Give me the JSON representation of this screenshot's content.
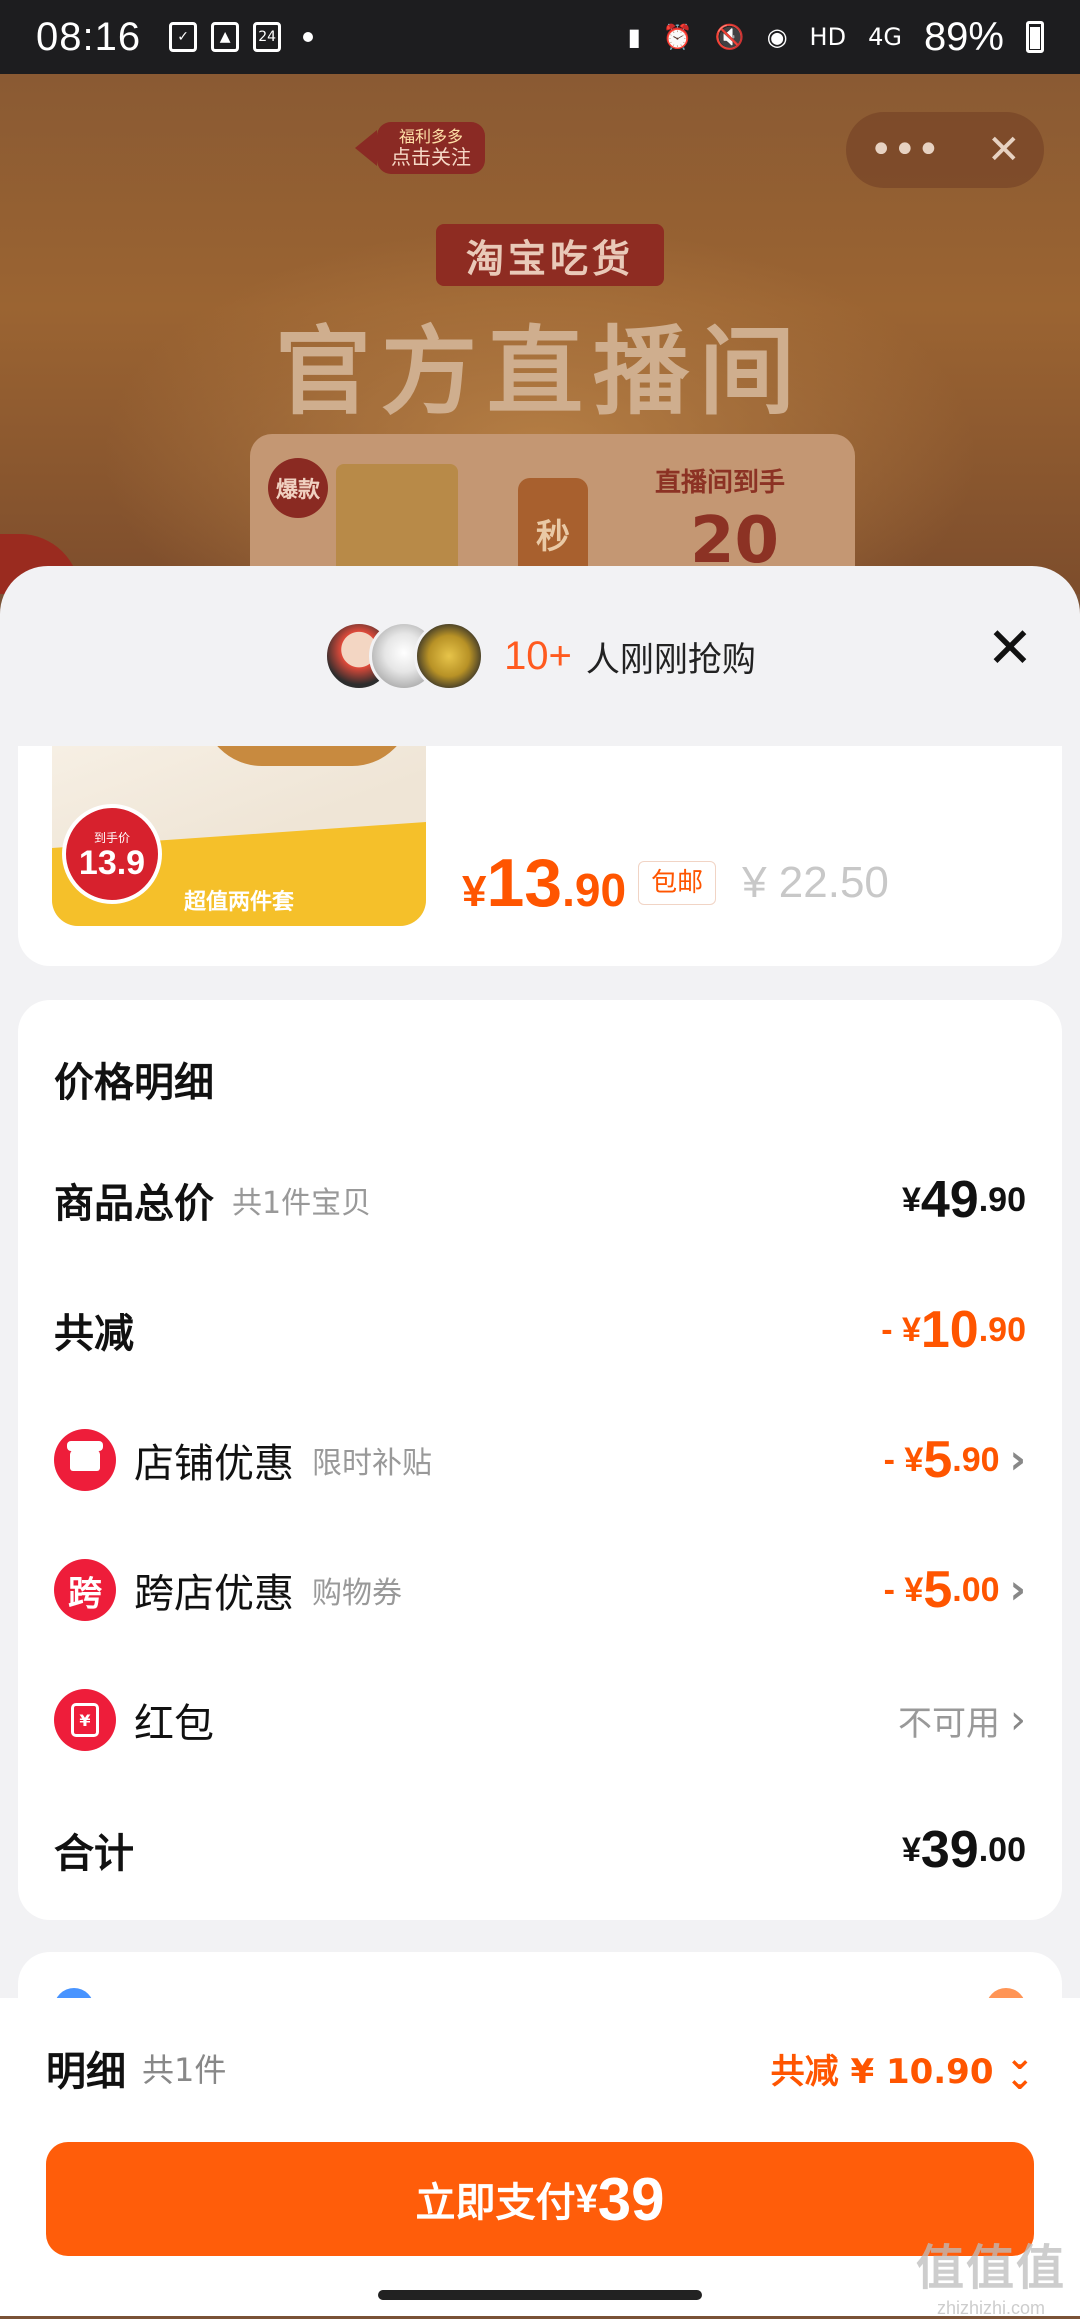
{
  "status_bar": {
    "time": "08:16",
    "network": "HD",
    "signal": "4G",
    "battery": "89%"
  },
  "live_room": {
    "follow_top": "福利多多",
    "follow_bottom": "点击关注",
    "tag": "淘宝吃货",
    "title": "官方直播间",
    "promo_hot": "爆款",
    "promo_sec": "秒",
    "promo_text": "直播间到手",
    "promo_num": "20",
    "controls_more": "•••",
    "controls_close": "✕"
  },
  "sheet": {
    "buyers_count": "10+",
    "buyers_text": "人刚刚抢购",
    "close": "✕"
  },
  "product": {
    "badge_label": "到手价",
    "badge_price": "13.9",
    "combo_label": "超值两件套",
    "price_symbol": "¥",
    "price_int": "13",
    "price_dec": ".90",
    "shipping_tag": "包邮",
    "original_price": "¥ 22.50"
  },
  "price_detail": {
    "title": "价格明细",
    "total_label": "商品总价",
    "total_sub": "共1件宝贝",
    "total_sym": "¥",
    "total_int": "49",
    "total_dec": ".90",
    "discount_label": "共减",
    "discount_sym": "- ¥",
    "discount_int": "10",
    "discount_dec": ".90",
    "store_label": "店铺优惠",
    "store_sub": "限时补贴",
    "store_sym": "- ¥",
    "store_int": "5",
    "store_dec": ".90",
    "cross_icon": "跨",
    "cross_label": "跨店优惠",
    "cross_sub": "购物券",
    "cross_sym": "- ¥",
    "cross_int": "5",
    "cross_dec": ".00",
    "redpacket_icon": "¥",
    "redpacket_label": "红包",
    "redpacket_status": "不可用",
    "sum_label": "合计",
    "sum_sym": "¥",
    "sum_int": "39",
    "sum_dec": ".00",
    "chevron": "›"
  },
  "footer": {
    "detail_label": "明细",
    "detail_count": "共1件",
    "discount_summary": "共减 ¥ 10.90",
    "pay_label": "立即支付",
    "pay_symbol": "¥",
    "pay_amount": "39"
  },
  "watermark": {
    "main": "值值值",
    "sub": "zhizhizhi.com"
  },
  "colors": {
    "accent": "#ff5500",
    "pay_button": "#ff5d0a",
    "icon_red": "#ee1d3a"
  }
}
